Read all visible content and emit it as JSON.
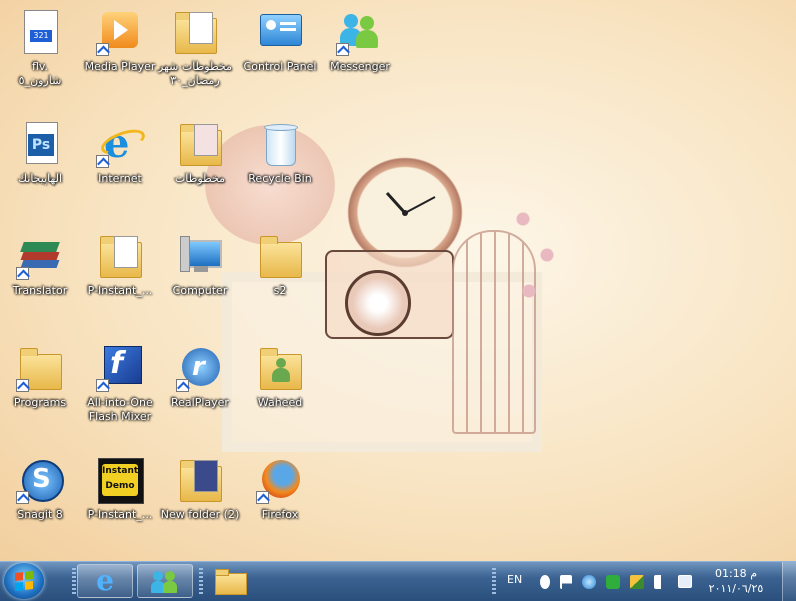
{
  "desktop": {
    "icons": [
      {
        "label": "flv.\nشارون_٥",
        "kind": "file-flv-icon"
      },
      {
        "label": "Media Player",
        "kind": "media-player-icon"
      },
      {
        "label": "مخطوطات شهر رمضان_٣٠",
        "kind": "folder-icon"
      },
      {
        "label": "Control Panel",
        "kind": "control-panel-icon"
      },
      {
        "label": "Messenger",
        "kind": "messenger-icon"
      },
      {
        "label": "الهاپيجانك",
        "kind": "photoshop-icon"
      },
      {
        "label": "Internet",
        "kind": "internet-explorer-icon"
      },
      {
        "label": "مخطوطات",
        "kind": "folder-icon"
      },
      {
        "label": "Recycle Bin",
        "kind": "recycle-bin-icon"
      },
      {
        "label": "Translator",
        "kind": "translator-icon"
      },
      {
        "label": "P-Instant_...",
        "kind": "folder-icon"
      },
      {
        "label": "Computer",
        "kind": "computer-icon"
      },
      {
        "label": "s2",
        "kind": "folder-icon"
      },
      {
        "label": "Programs",
        "kind": "folder-icon"
      },
      {
        "label": "All-into-One Flash Mixer",
        "kind": "flash-mixer-icon"
      },
      {
        "label": "RealPlayer",
        "kind": "realplayer-icon"
      },
      {
        "label": "Waheed",
        "kind": "user-folder-icon"
      },
      {
        "label": "Snagit 8",
        "kind": "snagit-icon"
      },
      {
        "label": "P-Instant_...",
        "kind": "instant-demo-icon"
      },
      {
        "label": "New folder (2)",
        "kind": "folder-icon"
      },
      {
        "label": "Firefox",
        "kind": "firefox-icon"
      }
    ],
    "instant_demo_logo": "Instant Demo"
  },
  "taskbar": {
    "pinned": [
      {
        "name": "internet-explorer"
      },
      {
        "name": "messenger"
      },
      {
        "name": "explorer"
      }
    ],
    "language": "EN",
    "tray_icons": [
      "bluetooth-icon",
      "action-center-icon",
      "network-globe-icon",
      "green-app-icon",
      "satellite-icon",
      "volume-muted-icon",
      "network-icon"
    ],
    "clock_time": "01:18 م",
    "clock_date": "٢٠١١/٠٦/٢٥"
  },
  "colors": {
    "taskbar": "#2a4f7c",
    "accent": "#1e6fc0"
  }
}
